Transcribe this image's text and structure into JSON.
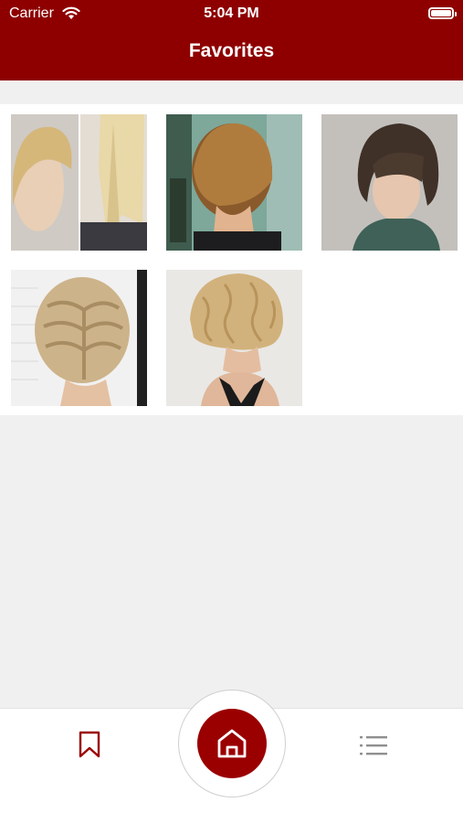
{
  "status_bar": {
    "carrier": "Carrier",
    "time": "5:04 PM",
    "battery_level": 1.0
  },
  "header": {
    "title": "Favorites"
  },
  "colors": {
    "brand": "#8e0000",
    "accent": "#9b0000",
    "background": "#f0f0f0"
  },
  "favorites": [
    {
      "icon": "split-blonde-haircut-photo"
    },
    {
      "icon": "stacked-bob-back-view-photo"
    },
    {
      "icon": "brunette-short-bob-photo"
    },
    {
      "icon": "blonde-braided-bob-photo"
    },
    {
      "icon": "wavy-blonde-bob-photo"
    }
  ],
  "tabbar": {
    "items": [
      {
        "icon": "bookmark-icon"
      },
      {
        "icon": "home-icon",
        "selected": true
      },
      {
        "icon": "list-icon"
      }
    ]
  }
}
